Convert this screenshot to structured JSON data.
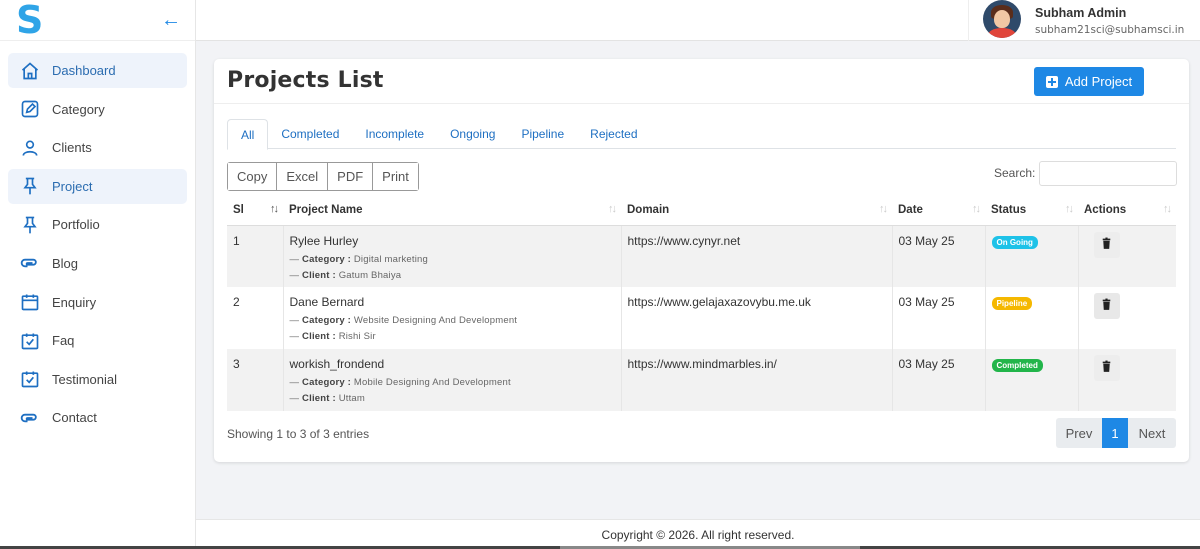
{
  "brand": {
    "logo": "S",
    "collapse_icon": "arrow-left-icon"
  },
  "sidebar": {
    "items": [
      {
        "label": "Dashboard",
        "icon": "home-icon",
        "active": true
      },
      {
        "label": "Category",
        "icon": "edit-square-icon",
        "active": false
      },
      {
        "label": "Clients",
        "icon": "user-icon",
        "active": false
      },
      {
        "label": "Project",
        "icon": "pin-icon",
        "active": true
      },
      {
        "label": "Portfolio",
        "icon": "pin-icon",
        "active": false
      },
      {
        "label": "Blog",
        "icon": "link-icon",
        "active": false
      },
      {
        "label": "Enquiry",
        "icon": "calendar-icon",
        "active": false
      },
      {
        "label": "Faq",
        "icon": "calendar-check-icon",
        "active": false
      },
      {
        "label": "Testimonial",
        "icon": "calendar-check-icon",
        "active": false
      },
      {
        "label": "Contact",
        "icon": "link-icon",
        "active": false
      }
    ]
  },
  "user": {
    "name": "Subham Admin",
    "email": "subham21sci@subhamsci.in"
  },
  "main": {
    "title": "Projects List",
    "add_button": "Add Project",
    "tabs": [
      "All",
      "Completed",
      "Incomplete",
      "Ongoing",
      "Pipeline",
      "Rejected"
    ],
    "active_tab": "All",
    "export_buttons": [
      "Copy",
      "Excel",
      "PDF",
      "Print"
    ],
    "search_label": "Search:",
    "search_value": "",
    "columns": [
      "Sl",
      "Project Name",
      "Domain",
      "Date",
      "Status",
      "Actions"
    ],
    "category_label": "Category :",
    "client_label": "Client :",
    "rows": [
      {
        "sl": "1",
        "name": "Rylee Hurley",
        "category": "Digital marketing",
        "client": "Gatum Bhaiya",
        "domain": "https://www.cynyr.net",
        "date": "03 May 25",
        "status": "On Going",
        "status_color": "#1ec2e8"
      },
      {
        "sl": "2",
        "name": "Dane Bernard",
        "category": "Website Designing And Development",
        "client": "Rishi Sir",
        "domain": "https://www.gelajaxazovybu.me.uk",
        "date": "03 May 25",
        "status": "Pipeline",
        "status_color": "#f5b800"
      },
      {
        "sl": "3",
        "name": "workish_frondend",
        "category": "Mobile Designing And Development",
        "client": "Uttam",
        "domain": "https://www.mindmarbles.in/",
        "date": "03 May 25",
        "status": "Completed",
        "status_color": "#22b54a"
      }
    ],
    "showing": "Showing 1 to 3 of 3 entries",
    "pagination": {
      "prev": "Prev",
      "current": "1",
      "next": "Next"
    }
  },
  "footer": {
    "text": "Copyright © 2026. All right reserved."
  },
  "colors": {
    "accent": "#1e88e5",
    "logo": "#2fa4e7"
  }
}
